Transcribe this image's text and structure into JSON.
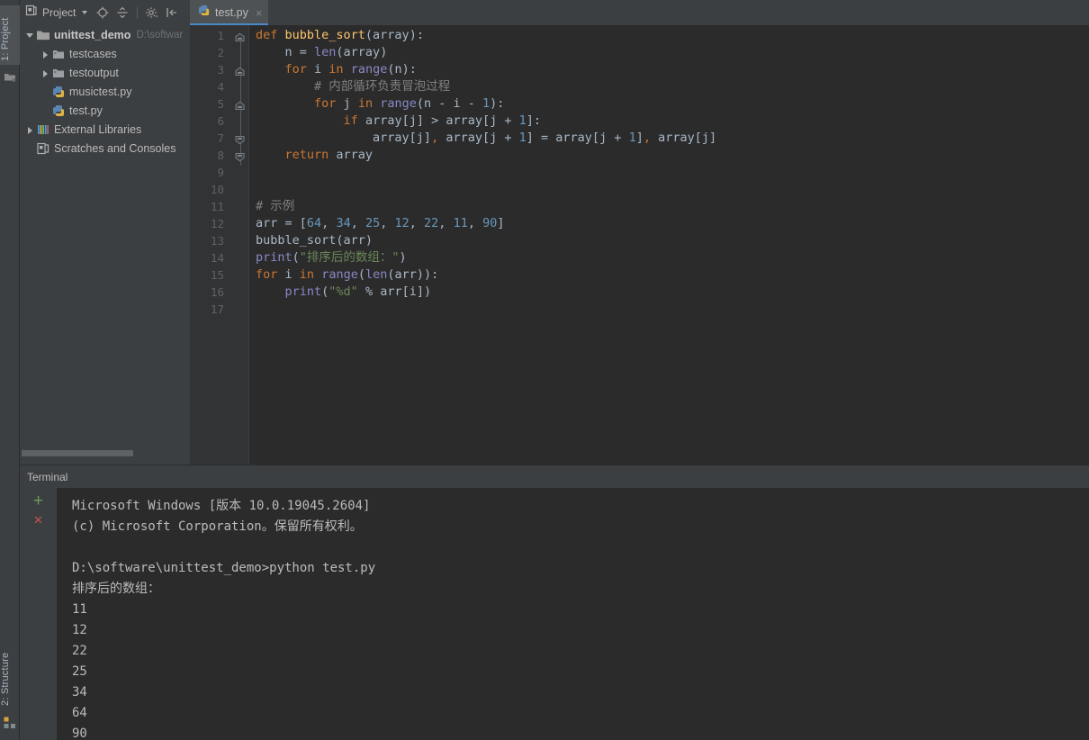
{
  "window": {
    "theme_bg": "#3c3f41",
    "editor_bg": "#2b2b2b",
    "accent": "#4a88c7"
  },
  "left_strip": {
    "project_tab": "1: Project",
    "structure_tab": "2: Structure",
    "project_icon": "project-panel-icon",
    "structure_icon": "structure-panel-icon"
  },
  "project_panel": {
    "title": "Project",
    "toolbar": [
      {
        "name": "select-opened-file-icon",
        "glyph": "locate-target"
      },
      {
        "name": "collapse-all-icon",
        "glyph": "collapse-all"
      },
      {
        "name": "settings-gear-icon",
        "glyph": "gear"
      },
      {
        "name": "hide-panel-icon",
        "glyph": "hide-left"
      }
    ],
    "tree": [
      {
        "label": "unittest_demo",
        "path": "D:\\softwar",
        "icon": "folder-module-icon",
        "expanded": true,
        "depth": 0,
        "bold": true
      },
      {
        "label": "testcases",
        "icon": "folder-icon",
        "expanded": false,
        "depth": 1,
        "bold": false
      },
      {
        "label": "testoutput",
        "icon": "folder-icon",
        "expanded": false,
        "depth": 1,
        "bold": false
      },
      {
        "label": "musictest.py",
        "icon": "python-file-icon",
        "depth": 1,
        "bold": false
      },
      {
        "label": "test.py",
        "icon": "python-file-icon",
        "depth": 1,
        "bold": false
      },
      {
        "label": "External Libraries",
        "icon": "library-icon",
        "expanded": false,
        "depth": 0,
        "bold": false
      },
      {
        "label": "Scratches and Consoles",
        "icon": "scratches-icon",
        "depth": 0,
        "bold": false
      }
    ]
  },
  "editor": {
    "tab": {
      "label": "test.py",
      "icon": "python-file-icon",
      "close": "×",
      "active": true
    },
    "line_numbers": [
      1,
      2,
      3,
      4,
      5,
      6,
      7,
      8,
      9,
      10,
      11,
      12,
      13,
      14,
      15,
      16,
      17
    ],
    "code_lines": [
      {
        "n": 1,
        "tokens": [
          {
            "t": "def ",
            "c": "kw"
          },
          {
            "t": "bubble_sort",
            "c": "fn"
          },
          {
            "t": "(array):",
            "c": "def"
          }
        ]
      },
      {
        "n": 2,
        "tokens": [
          {
            "t": "    n = ",
            "c": "def"
          },
          {
            "t": "len",
            "c": "bi"
          },
          {
            "t": "(array)",
            "c": "def"
          }
        ]
      },
      {
        "n": 3,
        "tokens": [
          {
            "t": "    ",
            "c": "def"
          },
          {
            "t": "for",
            "c": "kw"
          },
          {
            "t": " i ",
            "c": "def"
          },
          {
            "t": "in",
            "c": "kw"
          },
          {
            "t": " ",
            "c": "def"
          },
          {
            "t": "range",
            "c": "bi"
          },
          {
            "t": "(n):",
            "c": "def"
          }
        ]
      },
      {
        "n": 4,
        "tokens": [
          {
            "t": "        # 内部循环负责冒泡过程",
            "c": "cmt"
          }
        ]
      },
      {
        "n": 5,
        "tokens": [
          {
            "t": "        ",
            "c": "def"
          },
          {
            "t": "for",
            "c": "kw"
          },
          {
            "t": " j ",
            "c": "def"
          },
          {
            "t": "in",
            "c": "kw"
          },
          {
            "t": " ",
            "c": "def"
          },
          {
            "t": "range",
            "c": "bi"
          },
          {
            "t": "(n - i - ",
            "c": "def"
          },
          {
            "t": "1",
            "c": "num"
          },
          {
            "t": "):",
            "c": "def"
          }
        ]
      },
      {
        "n": 6,
        "tokens": [
          {
            "t": "            ",
            "c": "def"
          },
          {
            "t": "if",
            "c": "kw"
          },
          {
            "t": " array[j] > array[j + ",
            "c": "def"
          },
          {
            "t": "1",
            "c": "num"
          },
          {
            "t": "]:",
            "c": "def"
          }
        ]
      },
      {
        "n": 7,
        "tokens": [
          {
            "t": "                array[j]",
            "c": "def"
          },
          {
            "t": ",",
            "c": "kw"
          },
          {
            "t": " array[j + ",
            "c": "def"
          },
          {
            "t": "1",
            "c": "num"
          },
          {
            "t": "] = array[j + ",
            "c": "def"
          },
          {
            "t": "1",
            "c": "num"
          },
          {
            "t": "]",
            "c": "def"
          },
          {
            "t": ",",
            "c": "kw"
          },
          {
            "t": " array[j]",
            "c": "def"
          }
        ]
      },
      {
        "n": 8,
        "tokens": [
          {
            "t": "    ",
            "c": "def"
          },
          {
            "t": "return",
            "c": "kw"
          },
          {
            "t": " array",
            "c": "def"
          }
        ]
      },
      {
        "n": 9,
        "tokens": []
      },
      {
        "n": 10,
        "tokens": []
      },
      {
        "n": 11,
        "tokens": [
          {
            "t": "# 示例",
            "c": "cmt"
          }
        ]
      },
      {
        "n": 12,
        "tokens": [
          {
            "t": "arr = [",
            "c": "def"
          },
          {
            "t": "64",
            "c": "num"
          },
          {
            "t": ", ",
            "c": "def"
          },
          {
            "t": "34",
            "c": "num"
          },
          {
            "t": ", ",
            "c": "def"
          },
          {
            "t": "25",
            "c": "num"
          },
          {
            "t": ", ",
            "c": "def"
          },
          {
            "t": "12",
            "c": "num"
          },
          {
            "t": ", ",
            "c": "def"
          },
          {
            "t": "22",
            "c": "num"
          },
          {
            "t": ", ",
            "c": "def"
          },
          {
            "t": "11",
            "c": "num"
          },
          {
            "t": ", ",
            "c": "def"
          },
          {
            "t": "90",
            "c": "num"
          },
          {
            "t": "]",
            "c": "def"
          }
        ]
      },
      {
        "n": 13,
        "tokens": [
          {
            "t": "bubble_sort(arr)",
            "c": "def"
          }
        ]
      },
      {
        "n": 14,
        "tokens": [
          {
            "t": "print",
            "c": "bi"
          },
          {
            "t": "(",
            "c": "def"
          },
          {
            "t": "\"排序后的数组：\"",
            "c": "str"
          },
          {
            "t": ")",
            "c": "def"
          }
        ]
      },
      {
        "n": 15,
        "tokens": [
          {
            "t": "for",
            "c": "kw"
          },
          {
            "t": " i ",
            "c": "def"
          },
          {
            "t": "in",
            "c": "kw"
          },
          {
            "t": " ",
            "c": "def"
          },
          {
            "t": "range",
            "c": "bi"
          },
          {
            "t": "(",
            "c": "def"
          },
          {
            "t": "len",
            "c": "bi"
          },
          {
            "t": "(arr)):",
            "c": "def"
          }
        ]
      },
      {
        "n": 16,
        "tokens": [
          {
            "t": "    ",
            "c": "def"
          },
          {
            "t": "print",
            "c": "bi"
          },
          {
            "t": "(",
            "c": "def"
          },
          {
            "t": "\"%d\"",
            "c": "str"
          },
          {
            "t": " % arr[i])",
            "c": "def"
          }
        ]
      },
      {
        "n": 17,
        "tokens": []
      }
    ],
    "fold_markers": [
      1,
      3,
      5,
      7,
      8
    ]
  },
  "terminal": {
    "tab_label": "Terminal",
    "new_session_icon": "+",
    "close_session_icon": "×",
    "lines": [
      "Microsoft Windows [版本 10.0.19045.2604]",
      "(c) Microsoft Corporation。保留所有权利。",
      "",
      "D:\\software\\unittest_demo>python test.py",
      "排序后的数组：",
      "11",
      "12",
      "22",
      "25",
      "34",
      "64",
      "90"
    ]
  }
}
